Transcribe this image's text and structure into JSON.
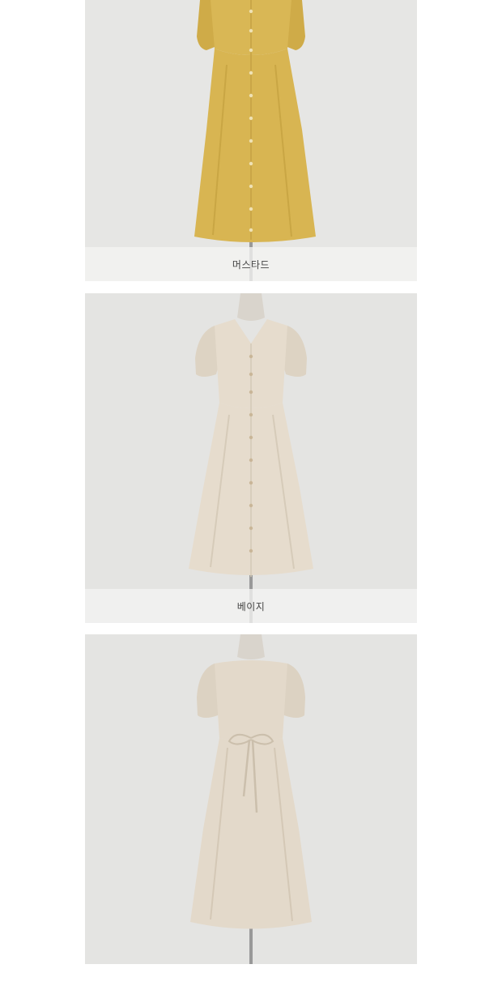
{
  "products": [
    {
      "caption": "머스타드",
      "dress_color": "#d8b552",
      "icon": "dress-front-image"
    },
    {
      "caption": "베이지",
      "dress_color": "#e6dccd",
      "icon": "dress-front-image"
    },
    {
      "caption": "",
      "dress_color": "#e3d9ca",
      "icon": "dress-back-image"
    }
  ]
}
